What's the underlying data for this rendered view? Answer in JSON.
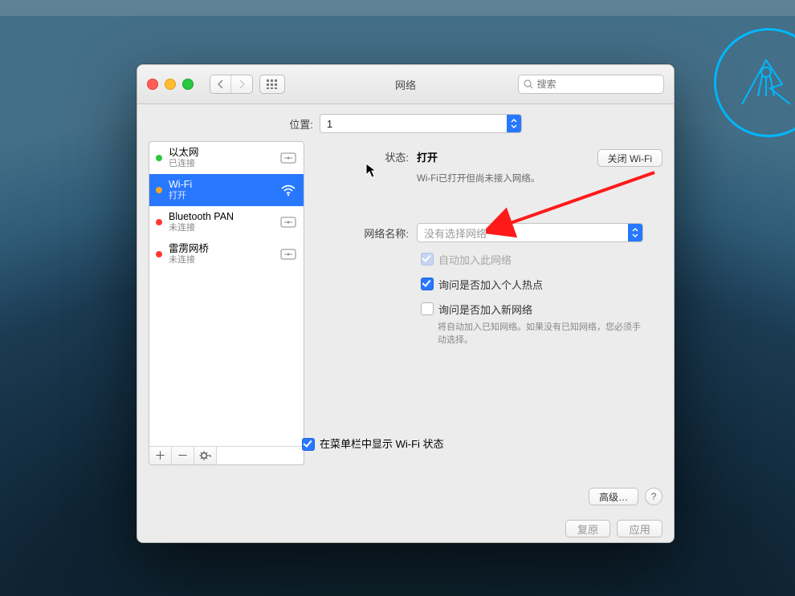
{
  "window": {
    "title": "网络",
    "search_placeholder": "搜索"
  },
  "location": {
    "label": "位置:",
    "value": "1"
  },
  "sidebar": {
    "items": [
      {
        "name": "以太网",
        "status": "已连接",
        "dot": "green"
      },
      {
        "name": "Wi-Fi",
        "status": "打开",
        "dot": "orange"
      },
      {
        "name": "Bluetooth PAN",
        "status": "未连接",
        "dot": "red"
      },
      {
        "name": "雷雳网桥",
        "status": "未连接",
        "dot": "red"
      }
    ]
  },
  "status": {
    "label": "状态:",
    "value": "打开",
    "sub": "Wi-Fi已打开但尚未接入网络。",
    "toggle_btn": "关闭 Wi-Fi"
  },
  "network_name": {
    "label": "网络名称:",
    "placeholder": "没有选择网络"
  },
  "checks": {
    "auto_join": "自动加入此网络",
    "ask_hotspot": "询问是否加入个人热点",
    "ask_new": "询问是否加入新网络",
    "ask_new_hint": "将自动加入已知网络。如果没有已知网络，您必须手动选择。"
  },
  "menubar_status": "在菜单栏中显示 Wi-Fi 状态",
  "buttons": {
    "advanced": "高级…",
    "revert": "复原",
    "apply": "应用"
  }
}
